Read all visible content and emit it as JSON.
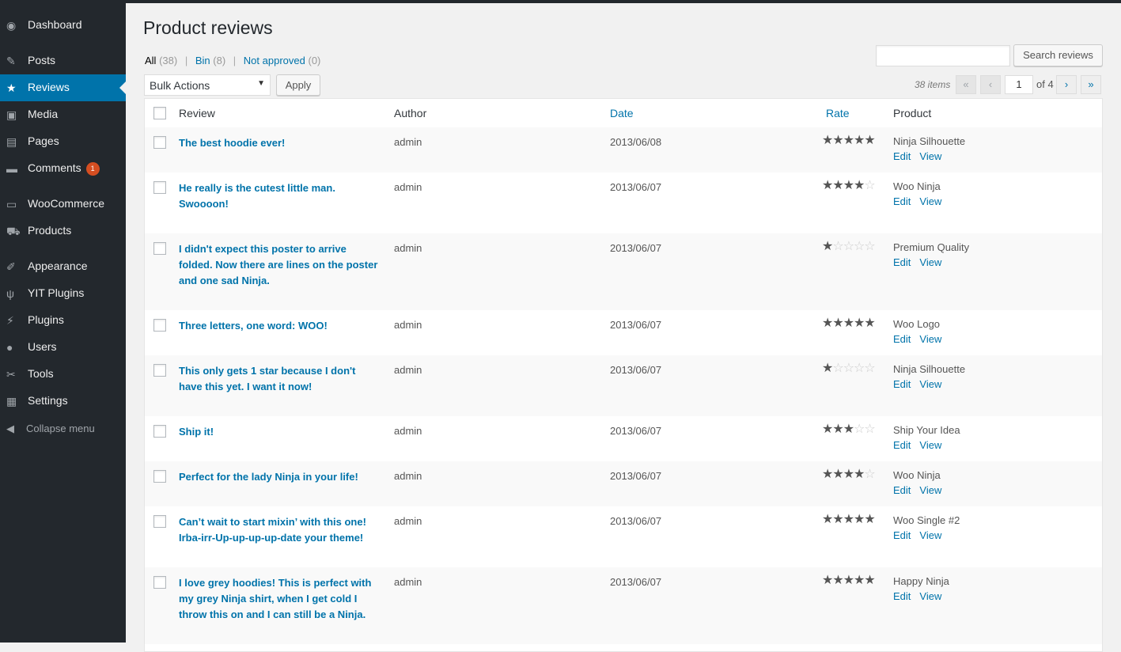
{
  "sidebar": {
    "items": [
      {
        "label": "Dashboard",
        "icon": "dashboard-icon",
        "glyph": "◉"
      },
      {
        "label": "Posts",
        "icon": "pushpin-icon",
        "glyph": "✎"
      },
      {
        "label": "Reviews",
        "icon": "star-icon",
        "glyph": "★"
      },
      {
        "label": "Media",
        "icon": "media-icon",
        "glyph": "▣"
      },
      {
        "label": "Pages",
        "icon": "pages-icon",
        "glyph": "▤"
      },
      {
        "label": "Comments",
        "icon": "comment-icon",
        "glyph": "▬",
        "badge": "1"
      },
      {
        "label": "WooCommerce",
        "icon": "woocommerce-icon",
        "glyph": "▭"
      },
      {
        "label": "Products",
        "icon": "cart-icon",
        "glyph": "⛟"
      },
      {
        "label": "Appearance",
        "icon": "brush-icon",
        "glyph": "✐"
      },
      {
        "label": "YIT Plugins",
        "icon": "yit-plugin-icon",
        "glyph": "ψ"
      },
      {
        "label": "Plugins",
        "icon": "plug-icon",
        "glyph": "⚡"
      },
      {
        "label": "Users",
        "icon": "user-icon",
        "glyph": "●"
      },
      {
        "label": "Tools",
        "icon": "wrench-icon",
        "glyph": "✂"
      },
      {
        "label": "Settings",
        "icon": "settings-icon",
        "glyph": "▦"
      }
    ],
    "collapse_label": "Collapse menu"
  },
  "page": {
    "title": "Product reviews",
    "filters": {
      "all_label": "All",
      "all_count": "(38)",
      "bin_label": "Bin",
      "bin_count": "(8)",
      "not_approved_label": "Not approved",
      "not_approved_count": "(0)"
    },
    "search_button": "Search reviews",
    "bulk_actions": "Bulk Actions",
    "apply": "Apply",
    "pagination": {
      "items": "38 items",
      "first": "«",
      "prev": "‹",
      "next": "›",
      "last": "»",
      "current": "1",
      "of_total": "of 4"
    }
  },
  "table": {
    "headers": {
      "review": "Review",
      "author": "Author",
      "date": "Date",
      "rate": "Rate",
      "product": "Product"
    },
    "edit_label": "Edit",
    "view_label": "View",
    "rows": [
      {
        "review": "The best hoodie ever!",
        "author": "admin",
        "date": "2013/06/08",
        "rating": 5,
        "product": "Ninja Silhouette"
      },
      {
        "review": "He really is the cutest little man. Swoooon!",
        "author": "admin",
        "date": "2013/06/07",
        "rating": 4,
        "product": "Woo Ninja"
      },
      {
        "review": "I didn't expect this poster to arrive folded. Now there are lines on the poster and one sad Ninja.",
        "author": "admin",
        "date": "2013/06/07",
        "rating": 1,
        "product": "Premium Quality"
      },
      {
        "review": "Three letters, one word: WOO!",
        "author": "admin",
        "date": "2013/06/07",
        "rating": 5,
        "product": "Woo Logo"
      },
      {
        "review": "This only gets 1 star because I don't have this yet. I want it now!",
        "author": "admin",
        "date": "2013/06/07",
        "rating": 1,
        "product": "Ninja Silhouette"
      },
      {
        "review": "Ship it!",
        "author": "admin",
        "date": "2013/06/07",
        "rating": 3,
        "product": "Ship Your Idea"
      },
      {
        "review": "Perfect for the lady Ninja in your life!",
        "author": "admin",
        "date": "2013/06/07",
        "rating": 4,
        "product": "Woo Ninja"
      },
      {
        "review": "Can’t wait to start mixin’ with this one! Irba-irr-Up-up-up-up-date your theme!",
        "author": "admin",
        "date": "2013/06/07",
        "rating": 5,
        "product": "Woo Single #2"
      },
      {
        "review": "I love grey hoodies! This is perfect with my grey Ninja shirt, when I get cold I throw this on and I can still be a Ninja.",
        "author": "admin",
        "date": "2013/06/07",
        "rating": 5,
        "product": "Happy Ninja"
      }
    ]
  },
  "colors": {
    "accent": "#0073aa",
    "sidebar_bg": "#23282d",
    "badge": "#d54e21"
  }
}
